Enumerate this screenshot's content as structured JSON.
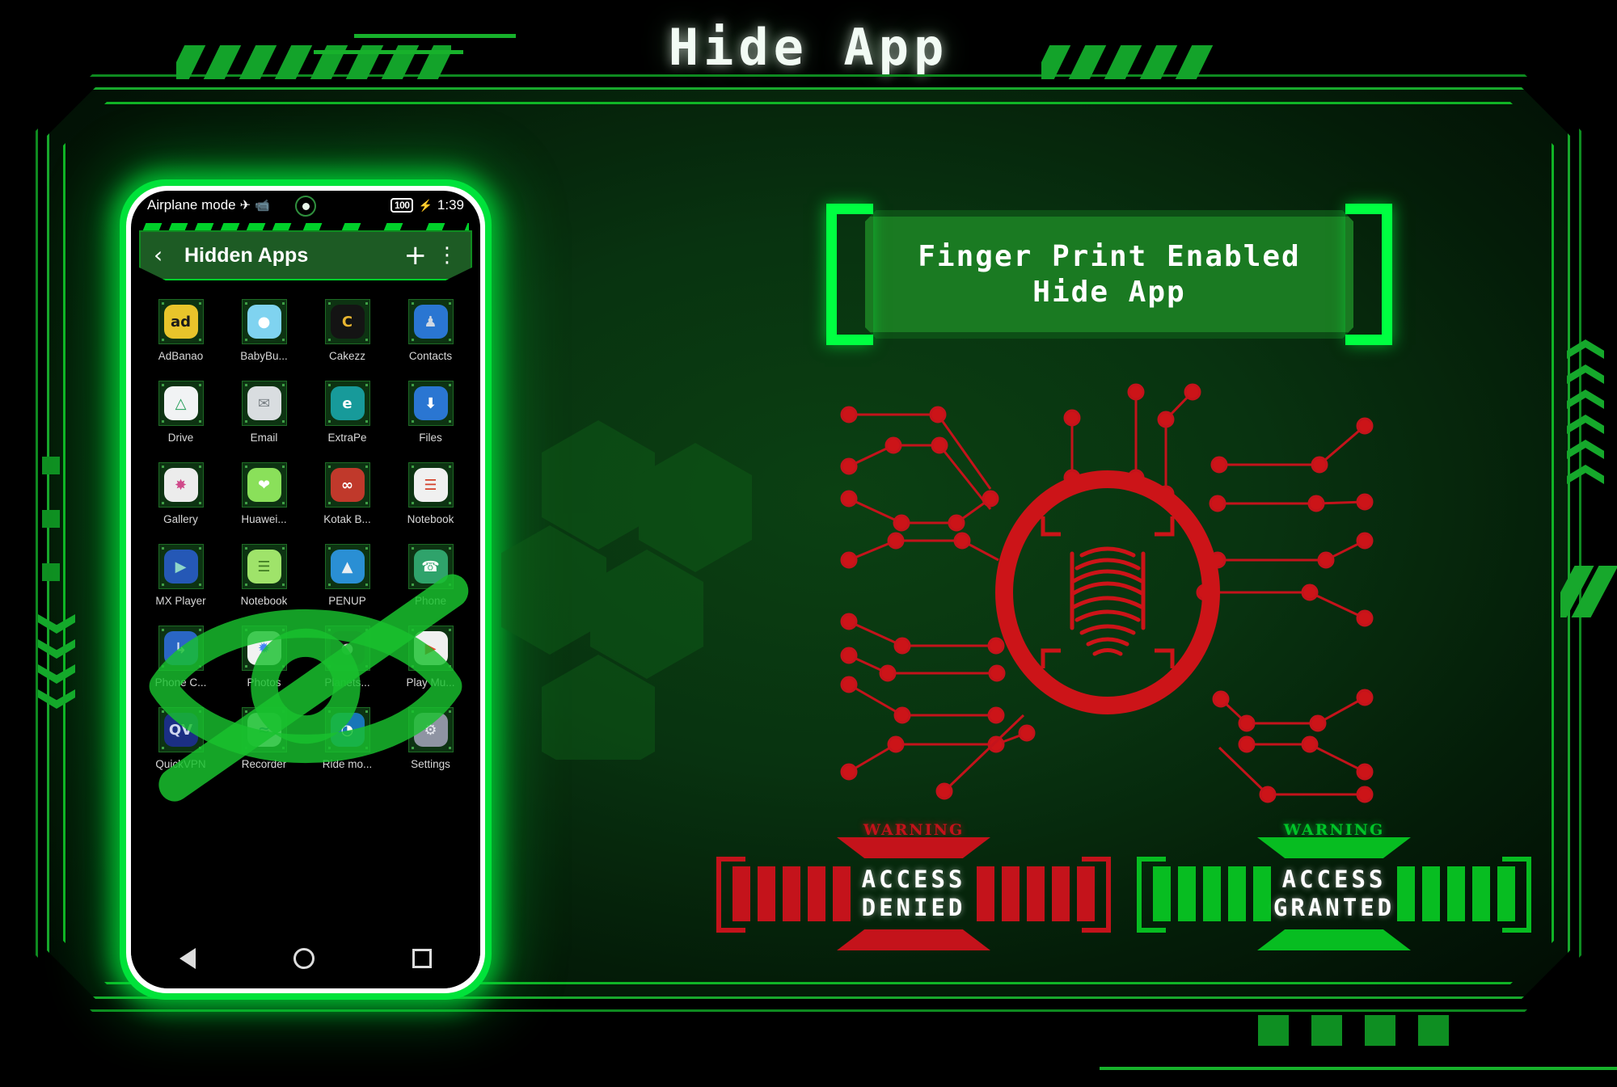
{
  "page": {
    "title": "Hide App"
  },
  "phone": {
    "status": {
      "left_text": "Airplane mode",
      "airplane_icon": "airplane-icon",
      "camera_icon": "camera-icon",
      "battery": "100",
      "charging_icon": "bolt-icon",
      "time": "1:39"
    },
    "appbar": {
      "back_icon": "chevron-left-icon",
      "title": "Hidden Apps",
      "add_icon": "plus-icon",
      "overflow_icon": "more-vertical-icon"
    },
    "apps": [
      {
        "label": "AdBanao",
        "icon": "adbanao-icon",
        "bg": "#e8c42b",
        "fg": "#1a1a1a",
        "glyph": "ad"
      },
      {
        "label": "BabyBu...",
        "icon": "babybus-icon",
        "bg": "#7fd3f0",
        "fg": "#ffffff",
        "glyph": "●"
      },
      {
        "label": "Cakezz",
        "icon": "cakezz-icon",
        "bg": "#141414",
        "fg": "#e8b530",
        "glyph": "C"
      },
      {
        "label": "Contacts",
        "icon": "contacts-icon",
        "bg": "#2a76d2",
        "fg": "#cfd8e3",
        "glyph": "♟"
      },
      {
        "label": "Drive",
        "icon": "drive-icon",
        "bg": "#f1f3f4",
        "fg": "#1f9d55",
        "glyph": "△"
      },
      {
        "label": "Email",
        "icon": "email-icon",
        "bg": "#d9dde0",
        "fg": "#7b8287",
        "glyph": "✉"
      },
      {
        "label": "ExtraPe",
        "icon": "extrape-icon",
        "bg": "#179a9a",
        "fg": "#ffffff",
        "glyph": "e"
      },
      {
        "label": "Files",
        "icon": "files-icon",
        "bg": "#2a76d2",
        "fg": "#ffffff",
        "glyph": "⬇"
      },
      {
        "label": "Gallery",
        "icon": "gallery-icon",
        "bg": "#ececec",
        "fg": "#d04a8a",
        "glyph": "✸"
      },
      {
        "label": "Huawei...",
        "icon": "huawei-health-icon",
        "bg": "#8ae05a",
        "fg": "#ffffff",
        "glyph": "❤"
      },
      {
        "label": "Kotak B...",
        "icon": "kotak-bank-icon",
        "bg": "#c0392b",
        "fg": "#ffffff",
        "glyph": "∞"
      },
      {
        "label": "Notebook",
        "icon": "notebook-icon",
        "bg": "#f0f0f0",
        "fg": "#d4402a",
        "glyph": "☰"
      },
      {
        "label": "MX Player",
        "icon": "mx-player-icon",
        "bg": "#2558b6",
        "fg": "#8fd6c8",
        "glyph": "▶"
      },
      {
        "label": "Notebook",
        "icon": "notebook2-icon",
        "bg": "#9fe36a",
        "fg": "#3f7a22",
        "glyph": "☰"
      },
      {
        "label": "PENUP",
        "icon": "penup-icon",
        "bg": "#2a8fd4",
        "fg": "#e8eef2",
        "glyph": "▲"
      },
      {
        "label": "Phone",
        "icon": "phone-icon",
        "bg": "#2fa36b",
        "fg": "#ffffff",
        "glyph": "☎"
      },
      {
        "label": "Phone C...",
        "icon": "phone-clone-icon",
        "bg": "#2a66c4",
        "fg": "#d6e3f5",
        "glyph": "↳"
      },
      {
        "label": "Photos",
        "icon": "photos-icon",
        "bg": "#f2f2f2",
        "fg": "#4285f4",
        "glyph": "✹"
      },
      {
        "label": "Planets...",
        "icon": "planets-icon",
        "bg": "#111111",
        "fg": "#cccccc",
        "glyph": "●"
      },
      {
        "label": "Play Mu...",
        "icon": "play-music-icon",
        "bg": "#f0f0f0",
        "fg": "#e8442d",
        "glyph": "▶"
      },
      {
        "label": "QuickVPN",
        "icon": "quickvpn-icon",
        "bg": "#1b2f84",
        "fg": "#cfd6f0",
        "glyph": "QV"
      },
      {
        "label": "Recorder",
        "icon": "recorder-icon",
        "bg": "#eceff1",
        "fg": "#2f6fb0",
        "glyph": "≈"
      },
      {
        "label": "Ride mo...",
        "icon": "ride-mode-icon",
        "bg": "#1976b8",
        "fg": "#ffffff",
        "glyph": "◔"
      },
      {
        "label": "Settings",
        "icon": "settings-icon",
        "bg": "#8f94a3",
        "fg": "#e8eaf0",
        "glyph": "⚙"
      }
    ],
    "navigation": {
      "back_icon": "nav-back-icon",
      "home_icon": "nav-home-icon",
      "recents_icon": "nav-recents-icon"
    },
    "watermark_icon": "eye-slash-hidden-icon"
  },
  "right_panel": {
    "banner": {
      "line1": "Finger Print Enabled",
      "line2": "Hide App"
    },
    "scanner": {
      "icon": "fingerprint-scan-icon",
      "ring_color": "#cc1418",
      "print_color": "#cc1418"
    },
    "badges": [
      {
        "warning": "WARNING",
        "line1": "ACCESS",
        "line2": "DENIED",
        "state": "denied",
        "color": "#c4131b"
      },
      {
        "warning": "WARNING",
        "line1": "ACCESS",
        "line2": "GRANTED",
        "state": "granted",
        "color": "#07bd21"
      }
    ]
  },
  "theme": {
    "accent_green": "#00e23a",
    "frame_green": "#15a82b",
    "banner_green": "#1a7a22",
    "danger_red": "#c4131b",
    "background": "#000000"
  }
}
